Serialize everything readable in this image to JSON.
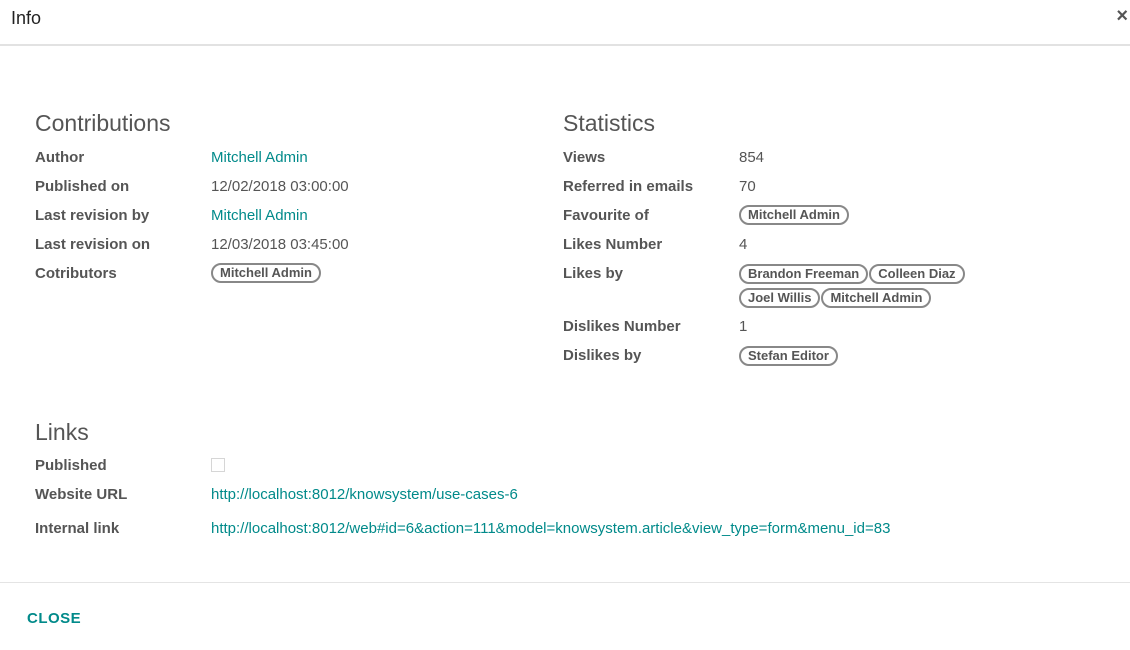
{
  "header": {
    "title": "Info",
    "close_icon": "×"
  },
  "contributions": {
    "title": "Contributions",
    "author_label": "Author",
    "author_value": "Mitchell Admin",
    "published_on_label": "Published on",
    "published_on_value": "12/02/2018 03:00:00",
    "last_revision_by_label": "Last revision by",
    "last_revision_by_value": "Mitchell Admin",
    "last_revision_on_label": "Last revision on",
    "last_revision_on_value": "12/03/2018 03:45:00",
    "contributors_label": "Cotributors",
    "contributors": [
      "Mitchell Admin"
    ]
  },
  "statistics": {
    "title": "Statistics",
    "views_label": "Views",
    "views_value": "854",
    "referred_label": "Referred in emails",
    "referred_value": "70",
    "favourite_label": "Favourite of",
    "favourite": [
      "Mitchell Admin"
    ],
    "likes_number_label": "Likes Number",
    "likes_number_value": "4",
    "likes_by_label": "Likes by",
    "likes_by": [
      "Brandon Freeman",
      "Colleen Diaz",
      "Joel Willis",
      "Mitchell Admin"
    ],
    "dislikes_number_label": "Dislikes Number",
    "dislikes_number_value": "1",
    "dislikes_by_label": "Dislikes by",
    "dislikes_by": [
      "Stefan Editor"
    ]
  },
  "links": {
    "title": "Links",
    "published_label": "Published",
    "published_checked": false,
    "website_url_label": "Website URL",
    "website_url_value": "http://localhost:8012/knowsystem/use-cases-6",
    "internal_link_label": "Internal link",
    "internal_link_value": "http://localhost:8012/web#id=6&action=111&model=knowsystem.article&view_type=form&menu_id=83"
  },
  "footer": {
    "close_label": "CLOSE"
  },
  "colors": {
    "accent": "#018a8a",
    "text": "#555555",
    "tag_border": "#888888"
  }
}
